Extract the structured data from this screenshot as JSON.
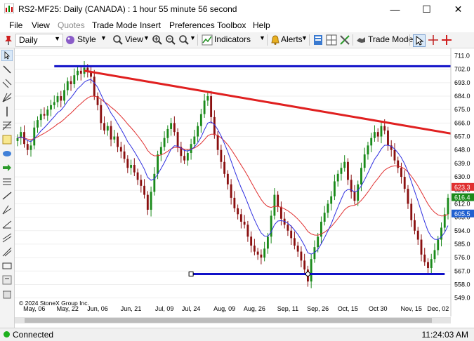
{
  "window": {
    "title": "RS2-MF25: Daily (CANADA) : 1 hour 55 minute 56 second",
    "minimize": "—",
    "maximize": "☐",
    "close": "✕"
  },
  "menu": [
    "File",
    "View",
    "Quotes",
    "Trade Mode",
    "Insert",
    "Preferences",
    "Toolbox",
    "Help"
  ],
  "toolbar": {
    "interval": "Daily",
    "style": "Style",
    "view": "View",
    "indicators": "Indicators",
    "alerts": "Alerts",
    "trade_mode": "Trade Mode"
  },
  "chart_data": {
    "type": "candlestick",
    "symbol": "RS2-MF25",
    "yticks": [
      711.0,
      702.0,
      693.0,
      684.0,
      675.0,
      666.0,
      657.0,
      648.0,
      639.0,
      630.0,
      621.0,
      612.0,
      603.0,
      594.0,
      585.0,
      576.0,
      567.0,
      558.0,
      549.0
    ],
    "ylim": [
      546,
      715
    ],
    "xticks": [
      "May, 06",
      "May, 22",
      "Jun, 06",
      "Jun, 21",
      "Jul, 09",
      "Jul, 24",
      "Aug, 09",
      "Aug, 26",
      "Sep, 11",
      "Sep, 26",
      "Oct, 15",
      "Oct 30",
      "Nov, 15",
      "Dec, 02"
    ],
    "closes": [
      656,
      660,
      652,
      648,
      651,
      663,
      668,
      672,
      671,
      675,
      678,
      680,
      684,
      681,
      688,
      694,
      692,
      698,
      701,
      699,
      703,
      700,
      697,
      684,
      678,
      666,
      661,
      664,
      655,
      657,
      650,
      647,
      642,
      636,
      638,
      633,
      628,
      624,
      618,
      608,
      620,
      632,
      645,
      650,
      656,
      662,
      666,
      660,
      650,
      644,
      641,
      646,
      652,
      657,
      664,
      672,
      681,
      684,
      670,
      658,
      648,
      640,
      632,
      625,
      616,
      609,
      605,
      600,
      598,
      590,
      584,
      580,
      578,
      576,
      582,
      590,
      604,
      618,
      610,
      602,
      598,
      594,
      589,
      584,
      580,
      574,
      568,
      560,
      575,
      583,
      590,
      600,
      606,
      612,
      617,
      627,
      632,
      636,
      640,
      628,
      620,
      614,
      625,
      636,
      645,
      651,
      656,
      660,
      657,
      664,
      661,
      651,
      648,
      641,
      636,
      630,
      622,
      612,
      601,
      594,
      588,
      578,
      573,
      569,
      575,
      581,
      588,
      596,
      605,
      616
    ],
    "ma_fast_label": "605.5",
    "ma_slow_label": "623.3",
    "last_price_label": "616.4",
    "trendlines": [
      {
        "name": "resistance-top",
        "color": "#1010c8",
        "y": 704
      },
      {
        "name": "support-bottom",
        "color": "#1010c8",
        "y": 565
      },
      {
        "name": "downtrend",
        "color": "#e02020",
        "y_start": 701,
        "y_end": 659
      }
    ],
    "colors": {
      "up": "#1a8a1a",
      "down": "#8a1010",
      "ma_fast": "#3030e0",
      "ma_slow": "#e03030",
      "fast_tag": "#2060d0",
      "slow_tag": "#e03030",
      "last_tag": "#1a8a1a"
    },
    "copyright": "© 2024 StoneX Group Inc."
  },
  "status": {
    "connection": "Connected",
    "time": "11:24:03 AM"
  }
}
